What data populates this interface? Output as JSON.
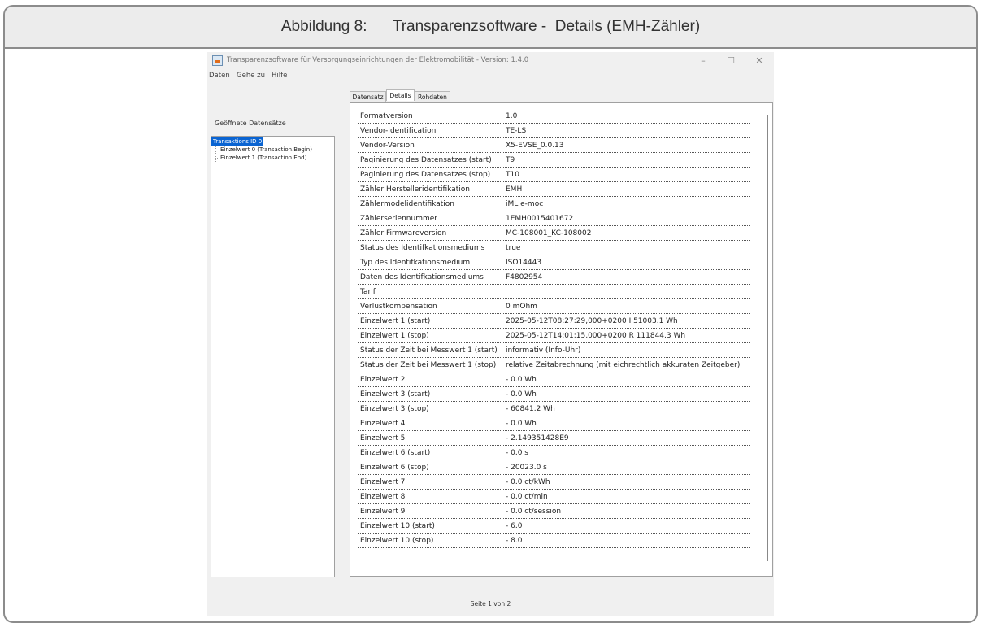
{
  "caption": "Abbildung 8:      Transparenzsoftware -  Details (EMH-Zähler)",
  "window": {
    "title": "Transparenzsoftware für Versorgungseinrichtungen der Elektromobilität - Version: 1.4.0",
    "controls": {
      "minimize": "–",
      "maximize": "☐",
      "close": "✕"
    },
    "icon": "java-app-icon"
  },
  "menu": [
    "Daten",
    "Gehe zu",
    "Hilfe"
  ],
  "sidebar": {
    "label": "Geöffnete Datensätze",
    "root": "Transaktions ID 0",
    "children": [
      "Einzelwert 0 (Transaction.Begin)",
      "Einzelwert 1 (Transaction.End)"
    ]
  },
  "tabs": [
    "Datensatz",
    "Details",
    "Rohdaten"
  ],
  "active_tab": "Details",
  "details": [
    {
      "key": "Formatversion",
      "value": "1.0"
    },
    {
      "key": "Vendor-Identification",
      "value": "TE-LS"
    },
    {
      "key": "Vendor-Version",
      "value": "X5-EVSE_0.0.13"
    },
    {
      "key": "Paginierung des Datensatzes (start)",
      "value": "T9"
    },
    {
      "key": "Paginierung des Datensatzes (stop)",
      "value": "T10"
    },
    {
      "key": "Zähler Herstelleridentifikation",
      "value": "EMH"
    },
    {
      "key": "Zählermodelidentifikation",
      "value": "iML e-moc"
    },
    {
      "key": "Zählerseriennummer",
      "value": "1EMH0015401672"
    },
    {
      "key": "Zähler Firmwareversion",
      "value": "MC-108001_KC-108002"
    },
    {
      "key": "Status des Identifkationsmediums",
      "value": "true"
    },
    {
      "key": "Typ des Identifkationsmedium",
      "value": "ISO14443"
    },
    {
      "key": "Daten des Identifkationsmediums",
      "value": "F4802954"
    },
    {
      "key": "Tarif",
      "value": ""
    },
    {
      "key": "Verlustkompensation",
      "value": "0 mOhm"
    },
    {
      "key": "Einzelwert 1 (start)",
      "value": "2025-05-12T08:27:29,000+0200 I 51003.1 Wh"
    },
    {
      "key": "Einzelwert 1 (stop)",
      "value": "2025-05-12T14:01:15,000+0200 R 111844.3 Wh"
    },
    {
      "key": "Status der Zeit bei Messwert 1 (start)",
      "value": "informativ (Info-Uhr)"
    },
    {
      "key": "Status der Zeit bei Messwert 1 (stop)",
      "value": "relative Zeitabrechnung (mit eichrechtlich akkuraten Zeitgeber)"
    },
    {
      "key": "Einzelwert 2",
      "value": "- 0.0 Wh"
    },
    {
      "key": "Einzelwert 3 (start)",
      "value": "- 0.0 Wh"
    },
    {
      "key": "Einzelwert 3 (stop)",
      "value": "- 60841.2 Wh"
    },
    {
      "key": "Einzelwert 4",
      "value": "- 0.0 Wh"
    },
    {
      "key": "Einzelwert 5",
      "value": "- 2.149351428E9"
    },
    {
      "key": "Einzelwert 6 (start)",
      "value": "- 0.0 s"
    },
    {
      "key": "Einzelwert 6 (stop)",
      "value": "- 20023.0 s"
    },
    {
      "key": "Einzelwert 7",
      "value": "- 0.0 ct/kWh"
    },
    {
      "key": "Einzelwert 8",
      "value": "- 0.0 ct/min"
    },
    {
      "key": "Einzelwert 9",
      "value": "- 0.0 ct/session"
    },
    {
      "key": "Einzelwert 10 (start)",
      "value": "- 6.0"
    },
    {
      "key": "Einzelwert 10 (stop)",
      "value": "- 8.0"
    }
  ],
  "pager": "Seite 1 von 2",
  "colors": {
    "selection": "#0a64d2",
    "window_bg": "#f0f0f0",
    "border": "#8c8c8c"
  }
}
